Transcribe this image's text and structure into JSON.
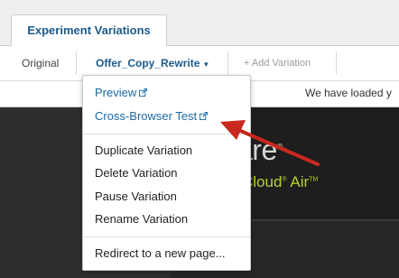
{
  "tabs": {
    "active_label": "Experiment Variations"
  },
  "variations": {
    "original": "Original",
    "selected": "Offer_Copy_Rewrite",
    "caret": "▼",
    "add": "+ Add Variation"
  },
  "notice": "We have loaded y",
  "hero": {
    "word": "are",
    "word_mark": "®",
    "sub": "Cloud",
    "sub_mark": "®",
    "sub2": " Air",
    "sub2_mark": "TM",
    "accent_color": "#bcd130"
  },
  "menu": {
    "preview": "Preview",
    "cross_browser": "Cross-Browser Test",
    "duplicate": "Duplicate Variation",
    "delete": "Delete Variation",
    "pause": "Pause Variation",
    "rename": "Rename Variation",
    "redirect": "Redirect to a new page...",
    "link_color": "#1a6aa6"
  },
  "annotation": {
    "arrow_color": "#c8281e"
  }
}
